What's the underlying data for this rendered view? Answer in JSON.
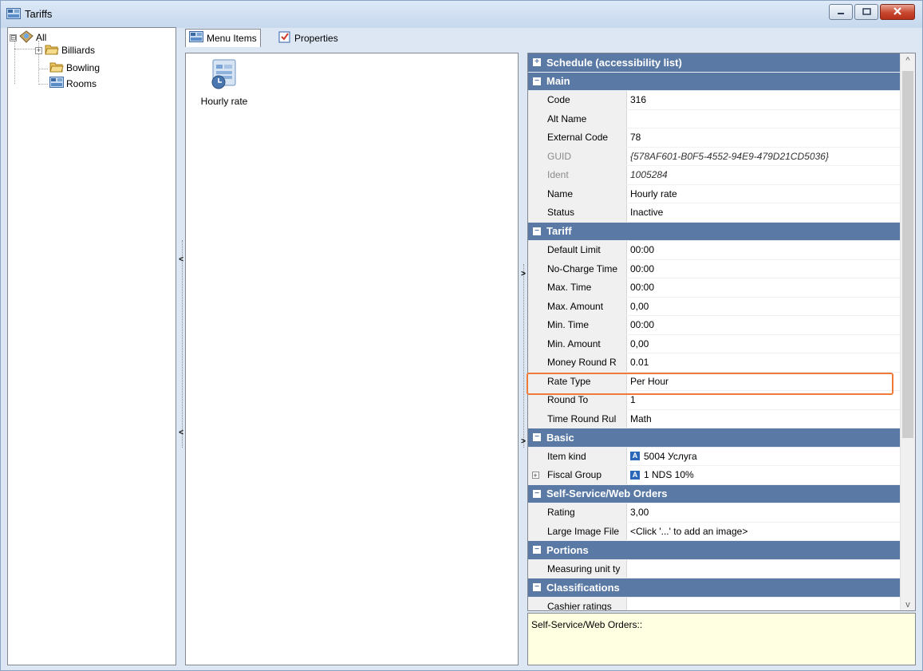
{
  "window": {
    "title": "Tariffs",
    "icon": "tariffs-icon",
    "controls": [
      "minimize-icon",
      "maximize-icon",
      "close-icon"
    ]
  },
  "tree": {
    "root": {
      "label": "All",
      "icon": "all-groups-icon",
      "expander": "⊟"
    },
    "children": [
      {
        "label": "Billiards",
        "icon": "folder-icon",
        "expander": "+"
      },
      {
        "label": "Bowling",
        "icon": "folder-icon"
      },
      {
        "label": "Rooms",
        "icon": "tariffs-icon"
      }
    ]
  },
  "tabs": [
    {
      "label": "Menu Items",
      "icon": "menu-items-icon",
      "active": true
    },
    {
      "label": "Properties",
      "icon": "properties-icon",
      "active": false
    }
  ],
  "items": [
    {
      "label": "Hourly rate",
      "icon": "hourly-rate-icon"
    }
  ],
  "splitters": {
    "left_arrow": "<",
    "right_arrow": ">"
  },
  "property_grid": {
    "rows": [
      {
        "type": "category",
        "symbol": "+",
        "label": "Schedule (accessibility list)"
      },
      {
        "type": "category",
        "symbol": "−",
        "label": "Main"
      },
      {
        "type": "prop",
        "name": "Code",
        "value": "316"
      },
      {
        "type": "prop",
        "name": "Alt Name",
        "value": ""
      },
      {
        "type": "prop",
        "name": "External Code",
        "value": "78"
      },
      {
        "type": "prop",
        "name": "GUID",
        "value": "{578AF601-B0F5-4552-94E9-479D21CD5036}",
        "readonly": true
      },
      {
        "type": "prop",
        "name": "Ident",
        "value": "1005284",
        "readonly": true
      },
      {
        "type": "prop",
        "name": "Name",
        "value": "Hourly rate"
      },
      {
        "type": "prop",
        "name": "Status",
        "value": "Inactive"
      },
      {
        "type": "category",
        "symbol": "−",
        "label": "Tariff"
      },
      {
        "type": "prop",
        "name": "Default Limit",
        "value": "00:00"
      },
      {
        "type": "prop",
        "name": "No-Charge Time",
        "value": "00:00"
      },
      {
        "type": "prop",
        "name": "Max. Time",
        "value": "00:00"
      },
      {
        "type": "prop",
        "name": "Max. Amount",
        "value": "0,00"
      },
      {
        "type": "prop",
        "name": "Min. Time",
        "value": "00:00"
      },
      {
        "type": "prop",
        "name": "Min. Amount",
        "value": "0,00"
      },
      {
        "type": "prop",
        "name": "Money Round R",
        "value": "0.01"
      },
      {
        "type": "prop",
        "name": "Rate Type",
        "value": "Per Hour",
        "highlighted": true
      },
      {
        "type": "prop",
        "name": "Round To",
        "value": "1"
      },
      {
        "type": "prop",
        "name": "Time Round Rul",
        "value": "Math"
      },
      {
        "type": "category",
        "symbol": "−",
        "label": "Basic"
      },
      {
        "type": "prop",
        "name": "Item kind",
        "value": "5004 Услуга",
        "badge": "A"
      },
      {
        "type": "prop",
        "name": "Fiscal Group",
        "value": "1 NDS 10%",
        "badge": "A",
        "expander": "+"
      },
      {
        "type": "category",
        "symbol": "−",
        "label": "Self-Service/Web Orders"
      },
      {
        "type": "prop",
        "name": "Rating",
        "value": "3,00"
      },
      {
        "type": "prop",
        "name": "Large Image File",
        "value": "<Click '...' to add an image>"
      },
      {
        "type": "category",
        "symbol": "−",
        "label": "Portions"
      },
      {
        "type": "prop",
        "name": "Measuring unit ty",
        "value": ""
      },
      {
        "type": "category",
        "symbol": "−",
        "label": "Classifications"
      },
      {
        "type": "prop",
        "name": "Cashier ratings",
        "value": ""
      }
    ],
    "scroll_up": "^",
    "scroll_down": "v"
  },
  "description": "Self-Service/Web Orders::",
  "colors": {
    "category_bg": "#5a7aa5",
    "highlight_border": "#f07a3a",
    "description_bg": "#ffffe1"
  }
}
